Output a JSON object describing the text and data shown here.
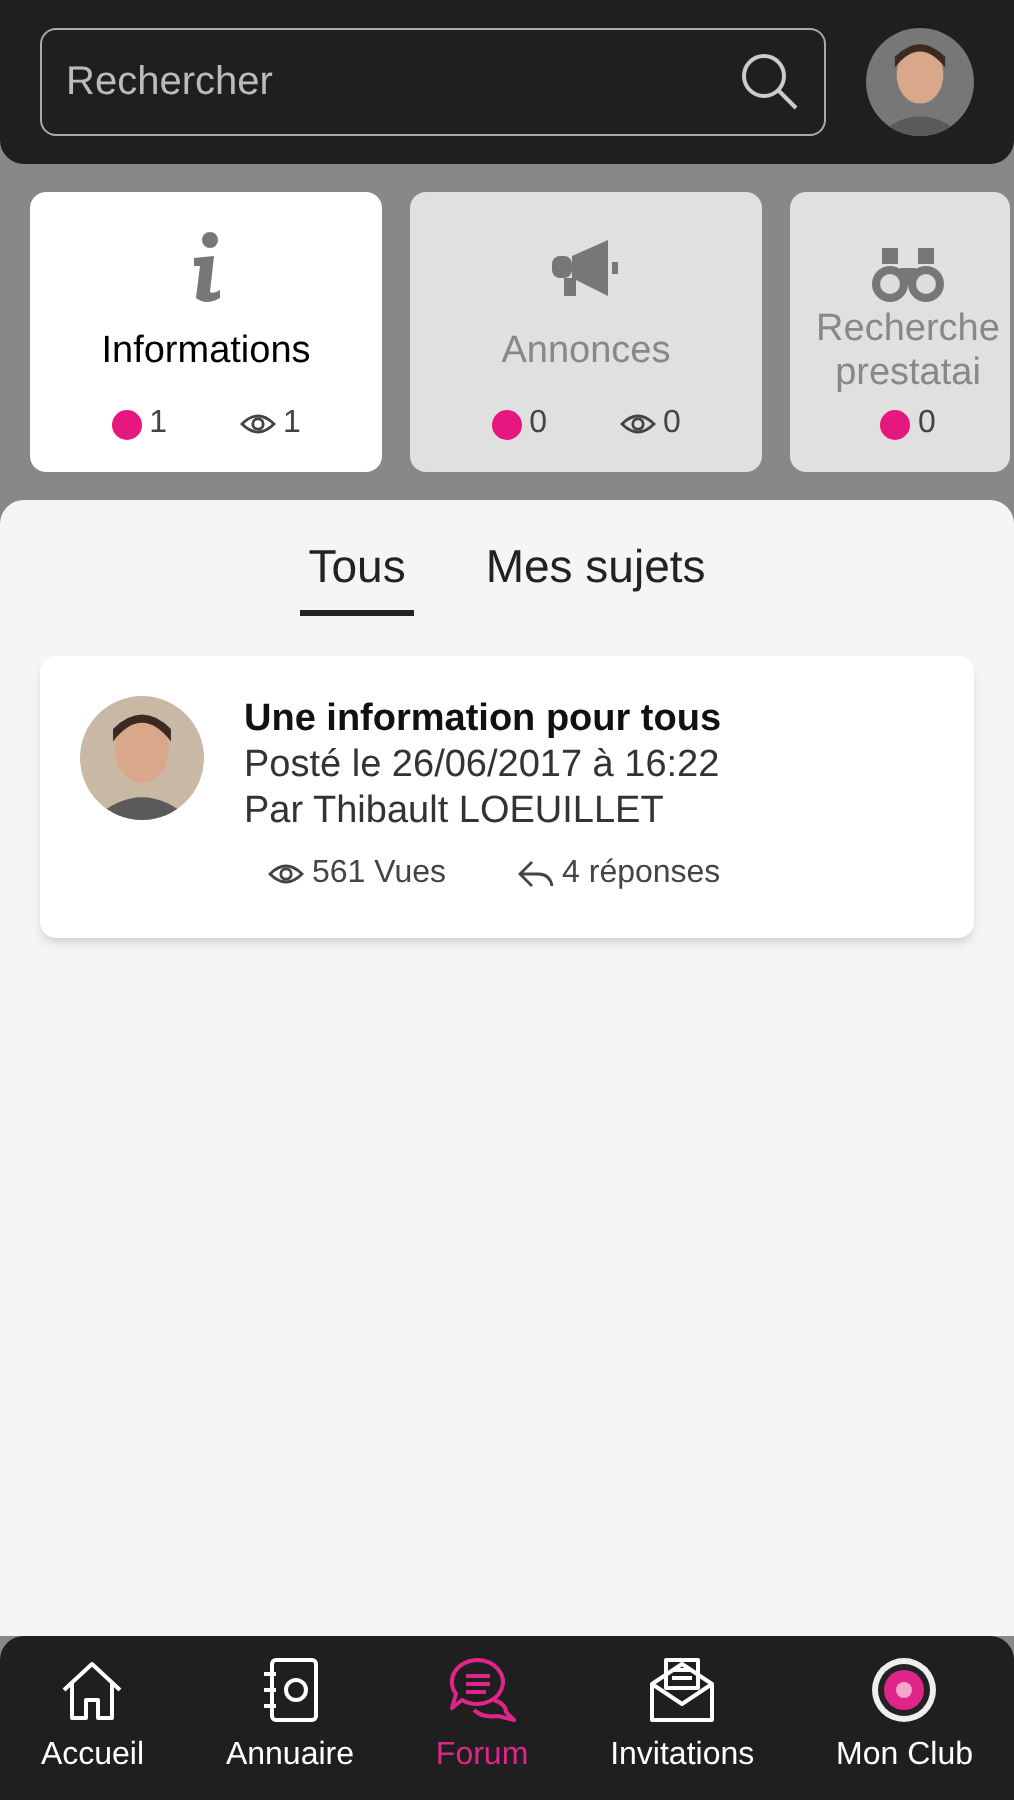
{
  "search": {
    "placeholder": "Rechercher"
  },
  "categories": [
    {
      "title": "Informations",
      "selected": true,
      "unread": "1",
      "views": "1"
    },
    {
      "title": "Annonces",
      "selected": false,
      "unread": "0",
      "views": "0"
    },
    {
      "title": "Recherche prestatai",
      "selected": false,
      "unread": "0"
    }
  ],
  "tabs": [
    {
      "label": "Tous",
      "selected": true
    },
    {
      "label": "Mes sujets",
      "selected": false
    }
  ],
  "topics": [
    {
      "title": "Une information pour tous",
      "posted": "Posté le 26/06/2017 à 16:22",
      "author": "Par Thibault LOEUILLET",
      "views": "561 Vues",
      "replies": "4 réponses"
    }
  ],
  "nav": [
    {
      "label": "Accueil",
      "selected": false
    },
    {
      "label": "Annuaire",
      "selected": false
    },
    {
      "label": "Forum",
      "selected": true
    },
    {
      "label": "Invitations",
      "selected": false
    },
    {
      "label": "Mon Club",
      "selected": false
    }
  ]
}
